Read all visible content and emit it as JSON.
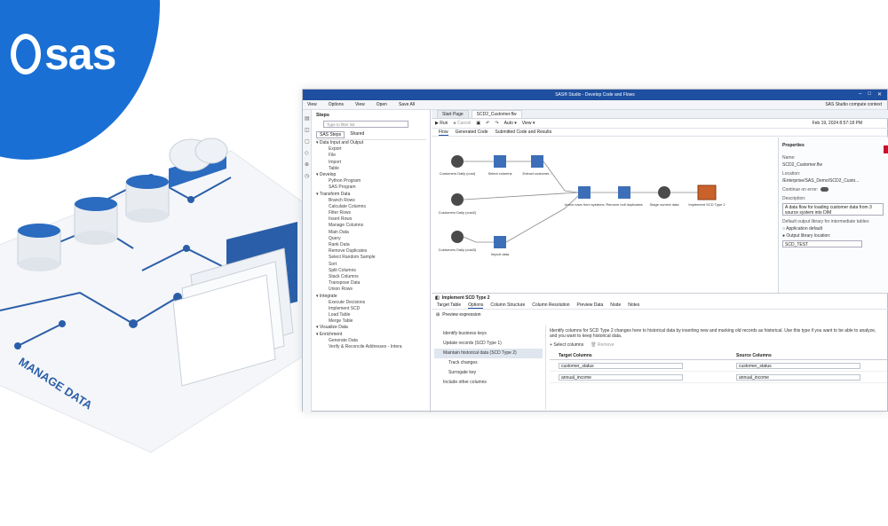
{
  "brand": {
    "logo_text": "sas",
    "color": "#1a6fd4"
  },
  "illustration": {
    "label": "MANAGE DATA"
  },
  "window": {
    "title": "SAS® Studio - Develop Code and Flows",
    "menu": [
      "View",
      "Options",
      "View",
      "Open",
      "Save All"
    ],
    "menu_right": "SAS Studio compute context",
    "steps_panel": {
      "title": "Steps",
      "search_placeholder": "Type to filter list",
      "subtabs": [
        "SAS Steps",
        "Shared"
      ],
      "tree": [
        {
          "type": "cat",
          "label": "Data Input and Output"
        },
        {
          "type": "itm",
          "label": "Export"
        },
        {
          "type": "itm",
          "label": "File"
        },
        {
          "type": "itm",
          "label": "Import"
        },
        {
          "type": "itm",
          "label": "Table"
        },
        {
          "type": "cat",
          "label": "Develop"
        },
        {
          "type": "itm",
          "label": "Python Program"
        },
        {
          "type": "itm",
          "label": "SAS Program"
        },
        {
          "type": "cat",
          "label": "Transform Data"
        },
        {
          "type": "itm",
          "label": "Branch Rows"
        },
        {
          "type": "itm",
          "label": "Calculate Columns"
        },
        {
          "type": "itm",
          "label": "Filter Rows"
        },
        {
          "type": "itm",
          "label": "Insert Rows"
        },
        {
          "type": "itm",
          "label": "Manage Columns"
        },
        {
          "type": "itm",
          "label": "Main Data"
        },
        {
          "type": "itm",
          "label": "Query"
        },
        {
          "type": "itm",
          "label": "Rank Data"
        },
        {
          "type": "itm",
          "label": "Remove Duplicates"
        },
        {
          "type": "itm",
          "label": "Select Random Sample"
        },
        {
          "type": "itm",
          "label": "Sort"
        },
        {
          "type": "itm",
          "label": "Split Columns"
        },
        {
          "type": "itm",
          "label": "Stack Columns"
        },
        {
          "type": "itm",
          "label": "Transpose Data"
        },
        {
          "type": "itm",
          "label": "Union Rows"
        },
        {
          "type": "cat",
          "label": "Integrate"
        },
        {
          "type": "itm",
          "label": "Execute Decisions"
        },
        {
          "type": "itm",
          "label": "Implement SCD"
        },
        {
          "type": "itm",
          "label": "Load Table"
        },
        {
          "type": "itm",
          "label": "Merge Table"
        },
        {
          "type": "cat",
          "label": "Visualize Data"
        },
        {
          "type": "cat",
          "label": "Enrichment"
        },
        {
          "type": "itm",
          "label": "Generate Data"
        },
        {
          "type": "itm",
          "label": "Verify & Reconcile Addresses - Intera"
        }
      ]
    },
    "doc_tabs": [
      "Start Page",
      "SCD2_Customer.flw"
    ],
    "toolbar": {
      "run": "Run",
      "cancel": "Cancel",
      "mode": "Auto",
      "view": "View",
      "timestamp": "Feb 19, 2024 8:57:18 PM"
    },
    "view_tabs": [
      "Flow",
      "Generated Code",
      "Submitted Code and Results"
    ],
    "flow_nodes": [
      {
        "id": "n1",
        "label": "Customers Daily (cust)"
      },
      {
        "id": "n2",
        "label": "Select columns"
      },
      {
        "id": "n3",
        "label": "Extract customer..."
      },
      {
        "id": "n4",
        "label": "Customers Daily (cust2)"
      },
      {
        "id": "n5",
        "label": "Union rows from systems"
      },
      {
        "id": "n6",
        "label": "Remove null duplicates"
      },
      {
        "id": "n7",
        "label": "Stage current data"
      },
      {
        "id": "n8",
        "label": "Implement SCD Type 2"
      },
      {
        "id": "n9",
        "label": "Customers Daily (cust3)"
      },
      {
        "id": "n10",
        "label": "Import data"
      }
    ],
    "properties": {
      "title": "Properties",
      "name_label": "Name:",
      "name_value": "SCD2_Customer.flw",
      "location_label": "Location:",
      "location_value": "/Enterprise/SAS_Demo/SCD2_Custo...",
      "continue_label": "Continue on error:",
      "description_label": "Description:",
      "description_value": "A data flow for loading customer data from 3 source system into DIM",
      "default_lib_label": "Default output library for intermediate tables:",
      "opt1": "Application default",
      "opt2": "Output library location:",
      "lib_value": "SCD_TEST"
    },
    "bottom": {
      "title": "Implement SCD Type 2",
      "tabs": [
        "Target Table",
        "Options",
        "Column Structure",
        "Column Resolution",
        "Preview Data",
        "Node",
        "Notes"
      ],
      "preview_label": "Preview expression",
      "options": [
        {
          "label": "Identify business keys",
          "sub": false
        },
        {
          "label": "Update records (SCD Type 1)",
          "sub": false
        },
        {
          "label": "Maintain historical data (SCD Type 2)",
          "sub": false
        },
        {
          "label": "Track changes",
          "sub": true
        },
        {
          "label": "Surrogate key",
          "sub": true
        },
        {
          "label": "Include other columns",
          "sub": false
        }
      ],
      "description": "Identify columns for SCD Type 2 changes here to historical data by inserting new and marking old records as historical. Use this type if you want to be able to analyze, and you want to keep historical data.",
      "select_columns": "Select columns",
      "remove": "Remove",
      "table": {
        "headers": [
          "Target Columns",
          "Source Columns"
        ],
        "rows": [
          [
            "customer_status",
            "customer_status"
          ],
          [
            "annual_income",
            "annual_income"
          ]
        ]
      }
    }
  }
}
